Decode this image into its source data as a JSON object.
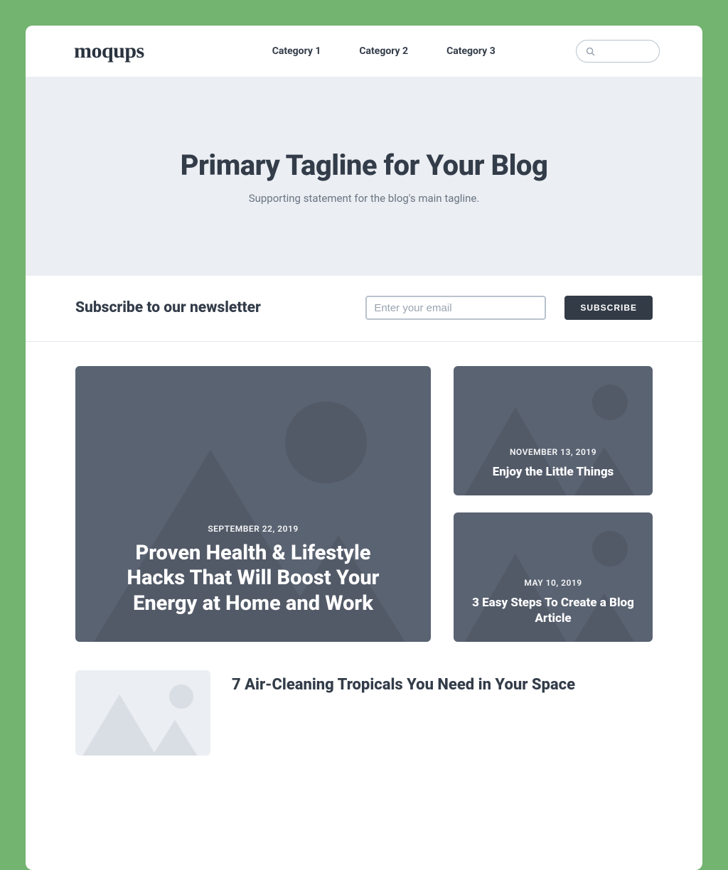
{
  "header": {
    "logo_text": "moqups",
    "nav": [
      "Category 1",
      "Category 2",
      "Category 3"
    ],
    "search_placeholder": ""
  },
  "hero": {
    "title": "Primary Tagline for Your Blog",
    "subtitle": "Supporting statement for the blog's main tagline."
  },
  "subscribe": {
    "heading": "Subscribe to our newsletter",
    "email_placeholder": "Enter your email",
    "button_label": "SUBSCRIBE"
  },
  "featured": {
    "date": "SEPTEMBER 22, 2019",
    "title": "Proven Health & Lifestyle Hacks That Will Boost Your Energy at Home and Work"
  },
  "side_posts": [
    {
      "date": "NOVEMBER 13, 2019",
      "title": "Enjoy the Little Things"
    },
    {
      "date": "MAY 10, 2019",
      "title": "3 Easy Steps To Create a Blog Article"
    }
  ],
  "list_post": {
    "title": "7 Air-Cleaning Tropicals You Need in Your Space"
  }
}
